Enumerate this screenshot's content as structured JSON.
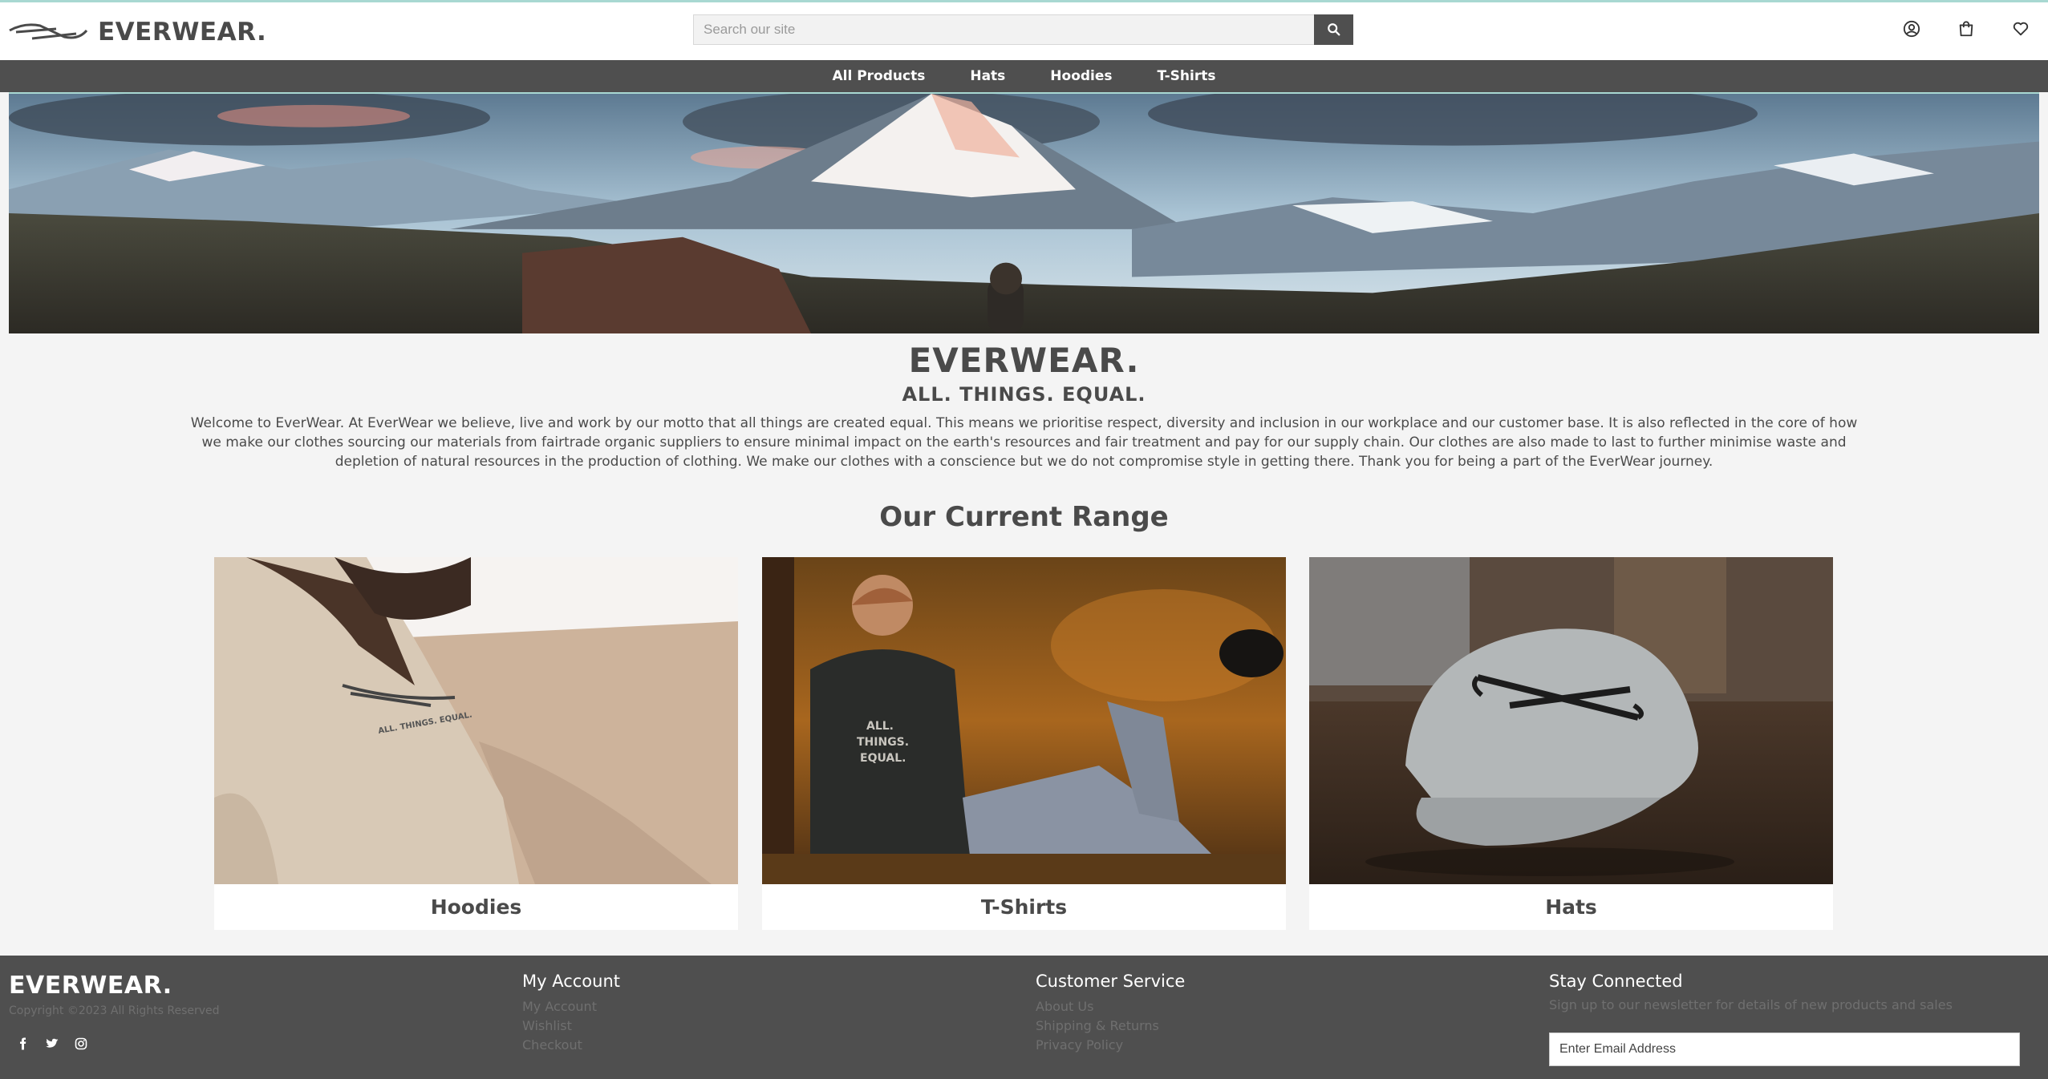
{
  "header": {
    "brand": "EVERWEAR.",
    "search_placeholder": "Search our site",
    "icons": [
      "account-icon",
      "shopping-bag-icon",
      "heart-icon"
    ]
  },
  "nav": {
    "items": [
      "All Products",
      "Hats",
      "Hoodies",
      "T-Shirts"
    ]
  },
  "intro": {
    "title": "EVERWEAR.",
    "motto": "ALL. THINGS. EQUAL.",
    "text": "Welcome to EverWear. At EverWear we believe, live and work by our motto that all things are created equal. This means we prioritise respect, diversity and inclusion in our workplace and our customer base. It is also reflected in the core of how we make our clothes sourcing our materials from fairtrade organic suppliers to ensure minimal impact on the earth's resources and fair treatment and pay for our supply chain. Our clothes are also made to last to further minimise waste and depletion of natural resources in the production of clothing. We make our clothes with a conscience but we do not compromise style in getting there. Thank you for being a part of the EverWear journey."
  },
  "range": {
    "title": "Our Current Range",
    "cards": [
      {
        "label": "Hoodies",
        "image_text": "ALL. THINGS. EQUAL."
      },
      {
        "label": "T-Shirts",
        "image_text": [
          "ALL.",
          "THINGS.",
          "EQUAL."
        ]
      },
      {
        "label": "Hats"
      }
    ]
  },
  "footer": {
    "brand": "EVERWEAR.",
    "copyright": "Copyright ©2023 All Rights Reserved",
    "socials": [
      "facebook-icon",
      "twitter-icon",
      "instagram-icon"
    ],
    "account": {
      "title": "My Account",
      "links": [
        "My Account",
        "Wishlist",
        "Checkout"
      ]
    },
    "service": {
      "title": "Customer Service",
      "links": [
        "About Us",
        "Shipping & Returns",
        "Privacy Policy"
      ]
    },
    "connect": {
      "title": "Stay Connected",
      "text": "Sign up to our newsletter for details of new products and sales",
      "email_placeholder": "Enter Email Address"
    }
  },
  "colors": {
    "nav_bg": "#4f4f4f",
    "page_bg": "#f4f4f4",
    "accent_line": "#a8d8d2",
    "text": "#4a4a4a"
  }
}
